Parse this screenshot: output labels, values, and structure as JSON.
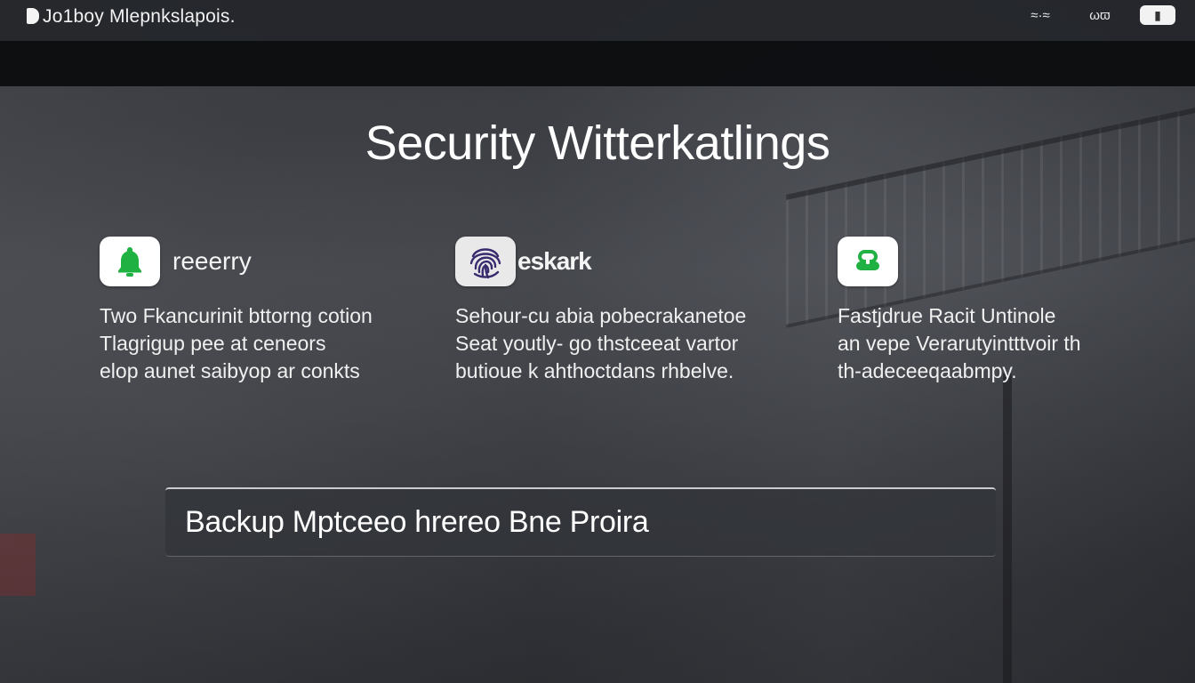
{
  "app": {
    "title": "Jo1boy Mlepnkslapois.",
    "logo_icon": "app-logo-icon"
  },
  "status": {
    "signal_text": "≈·≈",
    "wifi_text": "ωϖ",
    "battery_text": "▮"
  },
  "page": {
    "title": "Security Witterkatlings"
  },
  "features": [
    {
      "icon": "bell-icon",
      "icon_color": "#1fb141",
      "name": "reeerry",
      "description": "Two Fkancurinit bttorng cotion\nTlagrigup pee at ceneors\nelop aunet saibyop ar conkts"
    },
    {
      "icon": "fingerprint-icon",
      "icon_color": "#3a2a6e",
      "name": "eskark",
      "description": "Sehour-cu abia pobecrakanetoe\nSeat youtly- go thstceeat vartor\nbutioue k ahthoctdans rhbelve."
    },
    {
      "icon": "key-icon",
      "icon_color": "#1fb141",
      "name": "",
      "description": "Fastjdrue Racit Untinole\nan vepe Verarutyintttvoir th\nth-adeceeqaabmpy."
    }
  ],
  "backup": {
    "label": "Backup Mptceeo hrereo Bne Proira"
  }
}
